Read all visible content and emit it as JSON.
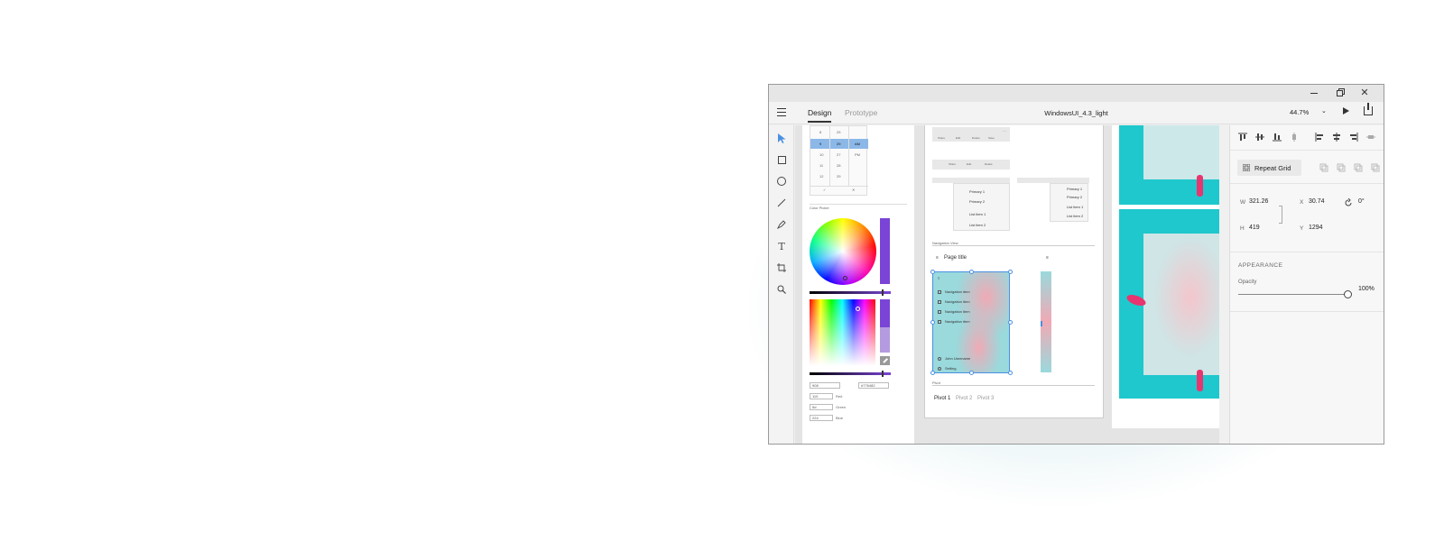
{
  "window": {
    "title": "WindowsUI_4.3_light"
  },
  "appbar": {
    "tabs": [
      {
        "label": "Design",
        "active": true
      },
      {
        "label": "Prototype",
        "active": false
      }
    ],
    "zoom": "44.7%"
  },
  "toolbar": {
    "tools": [
      "select-icon",
      "rectangle-icon",
      "ellipse-icon",
      "line-icon",
      "pen-icon",
      "text-icon",
      "artboard-icon",
      "zoom-icon"
    ]
  },
  "canvas": {
    "picker_rows": [
      [
        "8",
        "25",
        ""
      ],
      [
        "9",
        "29",
        "AM"
      ],
      [
        "10",
        "27",
        "PM"
      ],
      [
        "11",
        "28",
        ""
      ],
      [
        "12",
        "29",
        ""
      ]
    ],
    "color_picker_label": "Color Picker",
    "rgb_fields": [
      {
        "value": "908",
        "label": ""
      },
      {
        "value": "110",
        "label": "Red"
      },
      {
        "value": "5d",
        "label": "Green"
      },
      {
        "value": "224",
        "label": "Blue"
      }
    ],
    "hex_value": "#776482",
    "command_bar": [
      "Share",
      "Edit",
      "Delete",
      "Save"
    ],
    "command_bar2": [
      "Share",
      "Edit",
      "Delete"
    ],
    "menu_items": [
      "Primary 1",
      "Primary 2",
      "List item 1",
      "List item 2"
    ],
    "menu_items_right": [
      "Primary 1",
      "Primary 2",
      "List item 1",
      "List item 2"
    ],
    "navigation_view_label": "Navigation View",
    "page_title": "Page title",
    "nav_items": [
      "Navigation item",
      "Navigation item",
      "Navigation item",
      "Navigation item"
    ],
    "nav_footer": [
      "John Username",
      "Setting"
    ],
    "pivot_label": "Pivot",
    "pivots": [
      "Pivot 1",
      "Pivot 2",
      "Pivot 3"
    ]
  },
  "inspector": {
    "repeat_grid": "Repeat Grid",
    "w_label": "W",
    "w_value": "321.26",
    "x_label": "X",
    "x_value": "30.74",
    "h_label": "H",
    "h_value": "419",
    "y_label": "Y",
    "y_value": "1294",
    "rotation": "0°",
    "appearance": "APPEARANCE",
    "opacity_label": "Opacity",
    "opacity_value": "100%",
    "opacity_level": 1.0
  },
  "colors": {
    "accent_blue": "#4a90e2",
    "teal": "#1ec8cc",
    "pink": "#e8356f",
    "purple": "#7a45d6"
  }
}
